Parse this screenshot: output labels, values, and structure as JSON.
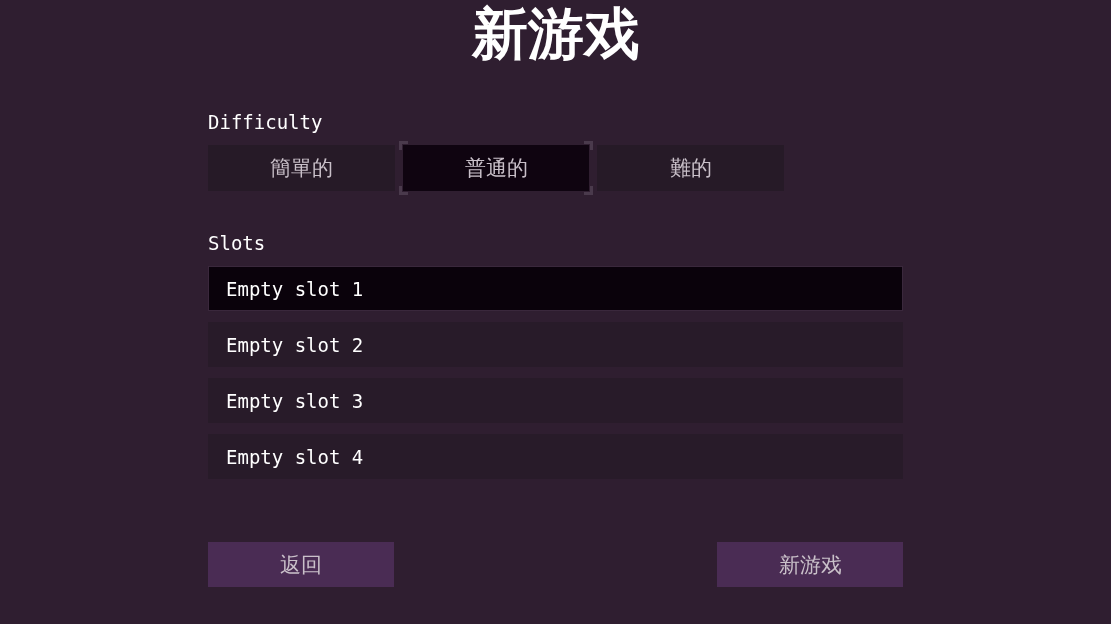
{
  "title": "新游戏",
  "difficulty": {
    "label": "Difficulty",
    "options": [
      {
        "label": "簡單的",
        "selected": false
      },
      {
        "label": "普通的",
        "selected": true
      },
      {
        "label": "難的",
        "selected": false
      }
    ]
  },
  "slots": {
    "label": "Slots",
    "items": [
      {
        "label": "Empty slot 1",
        "selected": true
      },
      {
        "label": "Empty slot 2",
        "selected": false
      },
      {
        "label": "Empty slot 3",
        "selected": false
      },
      {
        "label": "Empty slot 4",
        "selected": false
      }
    ]
  },
  "buttons": [
    {
      "label": "返回"
    },
    {
      "label": "新游戏"
    }
  ]
}
